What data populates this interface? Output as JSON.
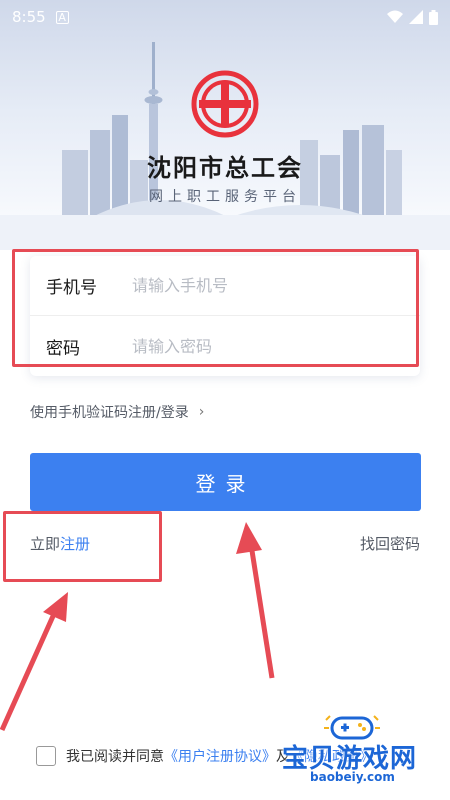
{
  "status_bar": {
    "time": "8:55",
    "notification_icon": "A",
    "wifi_icon": "wifi-icon",
    "signal_icon": "signal-icon",
    "battery_icon": "battery-icon"
  },
  "header": {
    "org_name": "沈阳市总工会",
    "subtitle": "网上职工服务平台"
  },
  "form": {
    "phone_label": "手机号",
    "phone_placeholder": "请输入手机号",
    "phone_value": "",
    "password_label": "密码",
    "password_placeholder": "请输入密码",
    "password_value": ""
  },
  "sms_login": {
    "label": "使用手机验证码注册/登录",
    "chevron": "›"
  },
  "login_button": {
    "label": "登录"
  },
  "register": {
    "prefix": "立即",
    "link": "注册"
  },
  "forgot_password": {
    "label": "找回密码"
  },
  "agreement": {
    "prefix": "我已阅读并同意",
    "user_agreement": "《用户注册协议》",
    "connector": "及",
    "privacy_policy": "《隐私政策》",
    "checked": false
  },
  "watermark": {
    "name": "宝贝游戏网",
    "url": "baobeiy.com"
  },
  "colors": {
    "primary": "#3c80f0",
    "logo_red": "#e8323c",
    "annotation_red": "#e64b55"
  }
}
